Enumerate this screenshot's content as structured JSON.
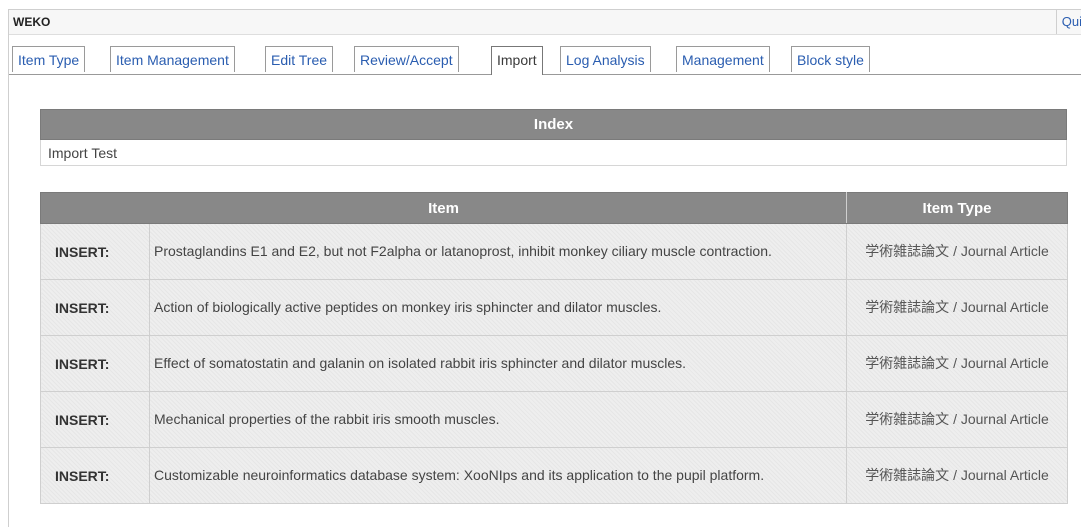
{
  "app": {
    "title": "WEKO",
    "quick_link": "Qui"
  },
  "tabs": [
    {
      "label": "Item Type",
      "active": false
    },
    {
      "label": "Item Management",
      "active": false
    },
    {
      "label": "Edit Tree",
      "active": false
    },
    {
      "label": "Review/Accept",
      "active": false
    },
    {
      "label": "Import",
      "active": true
    },
    {
      "label": "Log Analysis",
      "active": false
    },
    {
      "label": "Management",
      "active": false
    },
    {
      "label": "Block style",
      "active": false
    }
  ],
  "index_section": {
    "header": "Index",
    "value": "Import Test"
  },
  "items_section": {
    "headers": {
      "item": "Item",
      "item_type": "Item Type"
    },
    "rows": [
      {
        "operation": "INSERT:",
        "title": "Prostaglandins E1 and E2, but not F2alpha or latanoprost, inhibit monkey ciliary muscle contraction.",
        "item_type": "学術雑誌論文 / Journal Article"
      },
      {
        "operation": "INSERT:",
        "title": "Action of biologically active peptides on monkey iris sphincter and dilator muscles.",
        "item_type": "学術雑誌論文 / Journal Article"
      },
      {
        "operation": "INSERT:",
        "title": "Effect of somatostatin and galanin on isolated rabbit iris sphincter and dilator muscles.",
        "item_type": "学術雑誌論文 / Journal Article"
      },
      {
        "operation": "INSERT:",
        "title": "Mechanical properties of the rabbit iris smooth muscles.",
        "item_type": "学術雑誌論文 / Journal Article"
      },
      {
        "operation": "INSERT:",
        "title": "Customizable neuroinformatics database system: XooNIps and its application to the pupil platform.",
        "item_type": "学術雑誌論文 / Journal Article"
      }
    ]
  }
}
